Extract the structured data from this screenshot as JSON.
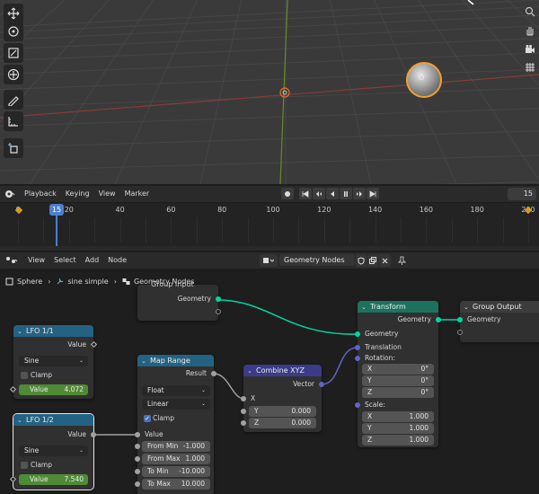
{
  "viewport": {
    "toolbar_icons": [
      "move-icon",
      "rotate-icon",
      "scale-icon",
      "transform-icon",
      "annotate-icon",
      "measure-icon",
      "add-cube-icon"
    ],
    "nav_icons": [
      "zoom-icon",
      "pan-icon",
      "camera-icon",
      "grid-icon"
    ]
  },
  "timeline": {
    "menu": [
      "Playback",
      "Keying",
      "View",
      "Marker"
    ],
    "current_frame": "15",
    "ticks": [
      "0",
      "20",
      "40",
      "60",
      "80",
      "100",
      "120",
      "140",
      "160",
      "180",
      "200"
    ]
  },
  "node_editor": {
    "menu": [
      "View",
      "Select",
      "Add",
      "Node"
    ],
    "tree_name": "Geometry Nodes",
    "breadcrumb": [
      "Sphere",
      "sine simple",
      "Geometry Nodes"
    ],
    "nodes": {
      "group_input": {
        "title": "Group Input",
        "out_geometry": "Geometry"
      },
      "lfo1": {
        "title": "LFO 1/1",
        "out": "Value",
        "mode": "Sine",
        "clamp": "Clamp",
        "value_label": "Value",
        "value": "4.072"
      },
      "lfo2": {
        "title": "LFO 1/2",
        "out": "Value",
        "mode": "Sine",
        "clamp": "Clamp",
        "value_label": "Value",
        "value": "7.540"
      },
      "map_range": {
        "title": "Map Range",
        "result": "Result",
        "data_type": "Float",
        "interp": "Linear",
        "clamp": "Clamp",
        "value": "Value",
        "from_min_label": "From Min",
        "from_min": "-1.000",
        "from_max_label": "From Max",
        "from_max": "1.000",
        "to_min_label": "To Min",
        "to_min": "-10.000",
        "to_max_label": "To Max",
        "to_max": "10.000"
      },
      "combine_xyz": {
        "title": "Combine XYZ",
        "out": "Vector",
        "x": "X",
        "y_label": "Y",
        "y": "0.000",
        "z_label": "Z",
        "z": "0.000"
      },
      "transform": {
        "title": "Transform",
        "out_geometry": "Geometry",
        "in_geometry": "Geometry",
        "translation": "Translation",
        "rotation": "Rotation:",
        "rx_label": "X",
        "rx": "0°",
        "ry_label": "Y",
        "ry": "0°",
        "rz_label": "Z",
        "rz": "0°",
        "scale": "Scale:",
        "sx_label": "X",
        "sx": "1.000",
        "sy_label": "Y",
        "sy": "1.000",
        "sz_label": "Z",
        "sz": "1.000"
      },
      "group_output": {
        "title": "Group Output",
        "in_geometry": "Geometry"
      }
    }
  },
  "colors": {
    "geometry_socket": "#00d6a3",
    "vector_socket": "#6363c7",
    "float_socket": "#a1a1a1",
    "input_header": "#3c3c3c",
    "converter_header": "#246283",
    "geometry_header": "#1d725e",
    "playhead": "#4c7fd0"
  }
}
